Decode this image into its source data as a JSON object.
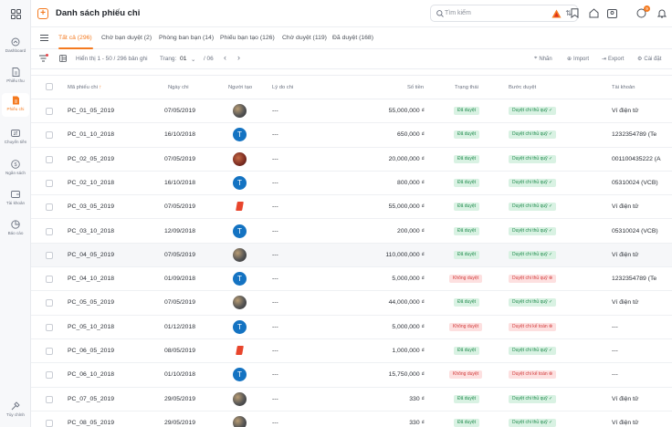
{
  "sidebar": {
    "items": [
      {
        "label": "Dashboard",
        "icon": "dashboard-icon"
      },
      {
        "label": "Phiếu thu",
        "icon": "receipt-icon"
      },
      {
        "label": "Phiếu chi",
        "icon": "payment-icon"
      },
      {
        "label": "Chuyển tiền",
        "icon": "transfer-icon"
      },
      {
        "label": "Ngân sách",
        "icon": "budget-icon"
      },
      {
        "label": "Tài khoản",
        "icon": "wallet-icon"
      },
      {
        "label": "Báo cáo",
        "icon": "report-icon"
      }
    ],
    "bottom_label": "Tùy chỉnh"
  },
  "header": {
    "title": "Danh sách phiếu chi",
    "search_placeholder": "Tìm kiếm",
    "notification_count": "9"
  },
  "tabs": [
    {
      "label": "Tất cả (296)"
    },
    {
      "label": "Chờ bạn duyệt (2)"
    },
    {
      "label": "Phòng ban bạn (14)"
    },
    {
      "label": "Phiếu bạn tạo (126)"
    },
    {
      "label": "Chờ duyệt (119)"
    },
    {
      "label": "Đã duyệt (168)"
    }
  ],
  "toolbar": {
    "range_text": "Hiển thị 1 - 50 / 296 bản ghi",
    "page_label": "Trang:",
    "page_current": "01",
    "page_total": "/ 06",
    "actions": [
      "Nhãn",
      "Import",
      "Export",
      "Cài đặt"
    ]
  },
  "table": {
    "columns": [
      "Mã phiếu chi",
      "Ngày chi",
      "Người tạo",
      "Lý do chi",
      "Số tiền",
      "Trạng thái",
      "Bước duyệt",
      "Tài khoản"
    ],
    "rows": [
      {
        "code": "PC_01_05_2019",
        "date": "07/05/2019",
        "creator": "photo",
        "reason": "---",
        "amount": "55,000,000 ₫",
        "status": "Đã duyệt",
        "status_type": "ok",
        "step": "Duyệt chi thủ quỹ ✓",
        "step_type": "ok",
        "account": "Ví điện tử"
      },
      {
        "code": "PC_01_10_2018",
        "date": "16/10/2018",
        "creator": "T",
        "reason": "---",
        "amount": "650,000 ₫",
        "status": "Đã duyệt",
        "status_type": "ok",
        "step": "Duyệt chi thủ quỹ ✓",
        "step_type": "ok",
        "account": "1232354789 (Te"
      },
      {
        "code": "PC_02_05_2019",
        "date": "07/05/2019",
        "creator": "red",
        "reason": "---",
        "amount": "20,000,000 ₫",
        "status": "Đã duyệt",
        "status_type": "ok",
        "step": "Duyệt chi thủ quỹ ✓",
        "step_type": "ok",
        "account": "001100435222 (A"
      },
      {
        "code": "PC_02_10_2018",
        "date": "16/10/2018",
        "creator": "T",
        "reason": "---",
        "amount": "800,000 ₫",
        "status": "Đã duyệt",
        "status_type": "ok",
        "step": "Duyệt chi thủ quỹ ✓",
        "step_type": "ok",
        "account": "05310024 (VCB)"
      },
      {
        "code": "PC_03_05_2019",
        "date": "07/05/2019",
        "creator": "logo",
        "reason": "---",
        "amount": "55,000,000 ₫",
        "status": "Đã duyệt",
        "status_type": "ok",
        "step": "Duyệt chi thủ quỹ ✓",
        "step_type": "ok",
        "account": "Ví điện tử"
      },
      {
        "code": "PC_03_10_2018",
        "date": "12/09/2018",
        "creator": "T",
        "reason": "---",
        "amount": "200,000 ₫",
        "status": "Đã duyệt",
        "status_type": "ok",
        "step": "Duyệt chi thủ quỹ ✓",
        "step_type": "ok",
        "account": "05310024 (VCB)"
      },
      {
        "code": "PC_04_05_2019",
        "date": "07/05/2019",
        "creator": "photo",
        "reason": "---",
        "amount": "110,000,000 ₫",
        "status": "Đã duyệt",
        "status_type": "ok",
        "step": "Duyệt chi thủ quỹ ✓",
        "step_type": "ok",
        "account": "Ví điện tử"
      },
      {
        "code": "PC_04_10_2018",
        "date": "01/09/2018",
        "creator": "T",
        "reason": "---",
        "amount": "5,000,000 ₫",
        "status": "Không duyệt",
        "status_type": "no",
        "step": "Duyệt chi thủ quỹ ⊗",
        "step_type": "no",
        "account": "1232354789 (Te"
      },
      {
        "code": "PC_05_05_2019",
        "date": "07/05/2019",
        "creator": "photo",
        "reason": "---",
        "amount": "44,000,000 ₫",
        "status": "Đã duyệt",
        "status_type": "ok",
        "step": "Duyệt chi thủ quỹ ✓",
        "step_type": "ok",
        "account": "Ví điện tử"
      },
      {
        "code": "PC_05_10_2018",
        "date": "01/12/2018",
        "creator": "T",
        "reason": "---",
        "amount": "5,000,000 ₫",
        "status": "Không duyệt",
        "status_type": "no",
        "step": "Duyệt chi kế toán ⊗",
        "step_type": "no",
        "account": "---"
      },
      {
        "code": "PC_06_05_2019",
        "date": "08/05/2019",
        "creator": "logo",
        "reason": "---",
        "amount": "1,000,000 ₫",
        "status": "Đã duyệt",
        "status_type": "ok",
        "step": "Duyệt chi thủ quỹ ✓",
        "step_type": "ok",
        "account": "---"
      },
      {
        "code": "PC_06_10_2018",
        "date": "01/10/2018",
        "creator": "T",
        "reason": "---",
        "amount": "15,750,000 ₫",
        "status": "Không duyệt",
        "status_type": "no",
        "step": "Duyệt chi kế toán ⊗",
        "step_type": "no",
        "account": "---"
      },
      {
        "code": "PC_07_05_2019",
        "date": "29/05/2019",
        "creator": "photo",
        "reason": "---",
        "amount": "330 ₫",
        "status": "Đã duyệt",
        "status_type": "ok",
        "step": "Duyệt chi thủ quỹ ✓",
        "step_type": "ok",
        "account": "Ví điện tử"
      },
      {
        "code": "PC_08_05_2019",
        "date": "29/05/2019",
        "creator": "photo",
        "reason": "---",
        "amount": "330 ₫",
        "status": "Đã duyệt",
        "status_type": "ok",
        "step": "Duyệt chi thủ quỹ ✓",
        "step_type": "ok",
        "account": "Ví điện tử"
      }
    ]
  }
}
